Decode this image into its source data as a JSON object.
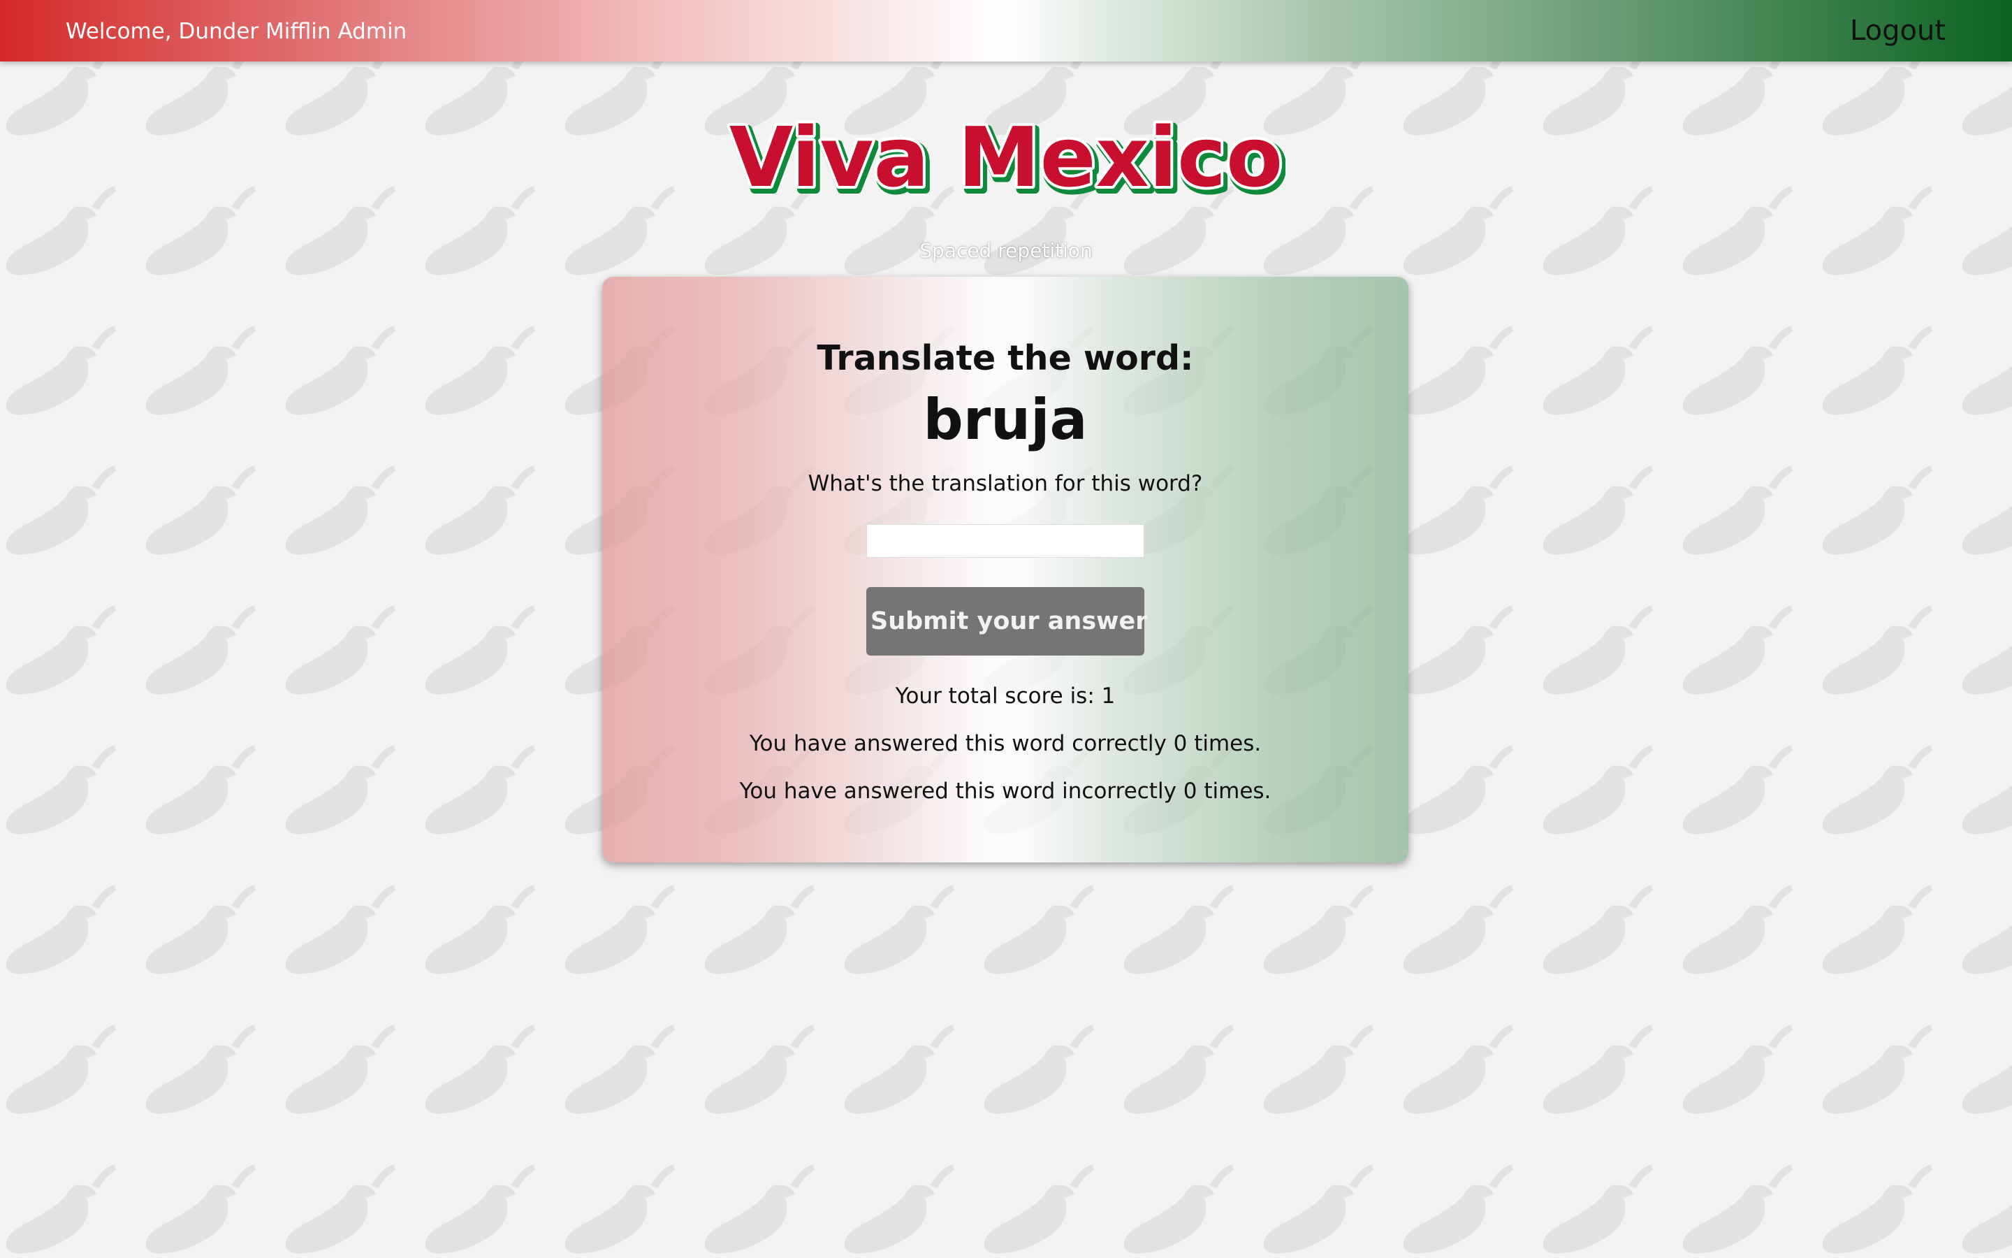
{
  "header": {
    "welcome_text": "Welcome, Dunder Mifflin Admin",
    "logout_label": "Logout"
  },
  "brand": {
    "title": "¡Viva Mexico!",
    "subtitle": "Spaced repetition",
    "title_color": "#c8102e",
    "title_outline_color": "#0f8a3a"
  },
  "background": {
    "pattern_icon": "chili-pepper-icon",
    "pattern_color": "#e2e2e2",
    "base_color": "#f3f3f3"
  },
  "card": {
    "heading": "Translate the word:",
    "word": "bruja",
    "question": "What's the translation for this word?",
    "answer_input": {
      "value": "",
      "placeholder": ""
    },
    "submit_label": "Submit your answer",
    "score_text": "Your total score is: 1",
    "correct_text": "You have answered this word correctly 0 times.",
    "incorrect_text": "You have answered this word incorrectly 0 times."
  },
  "colors": {
    "red": "#d42a2a",
    "green": "#0b6321",
    "button": "#757575"
  }
}
